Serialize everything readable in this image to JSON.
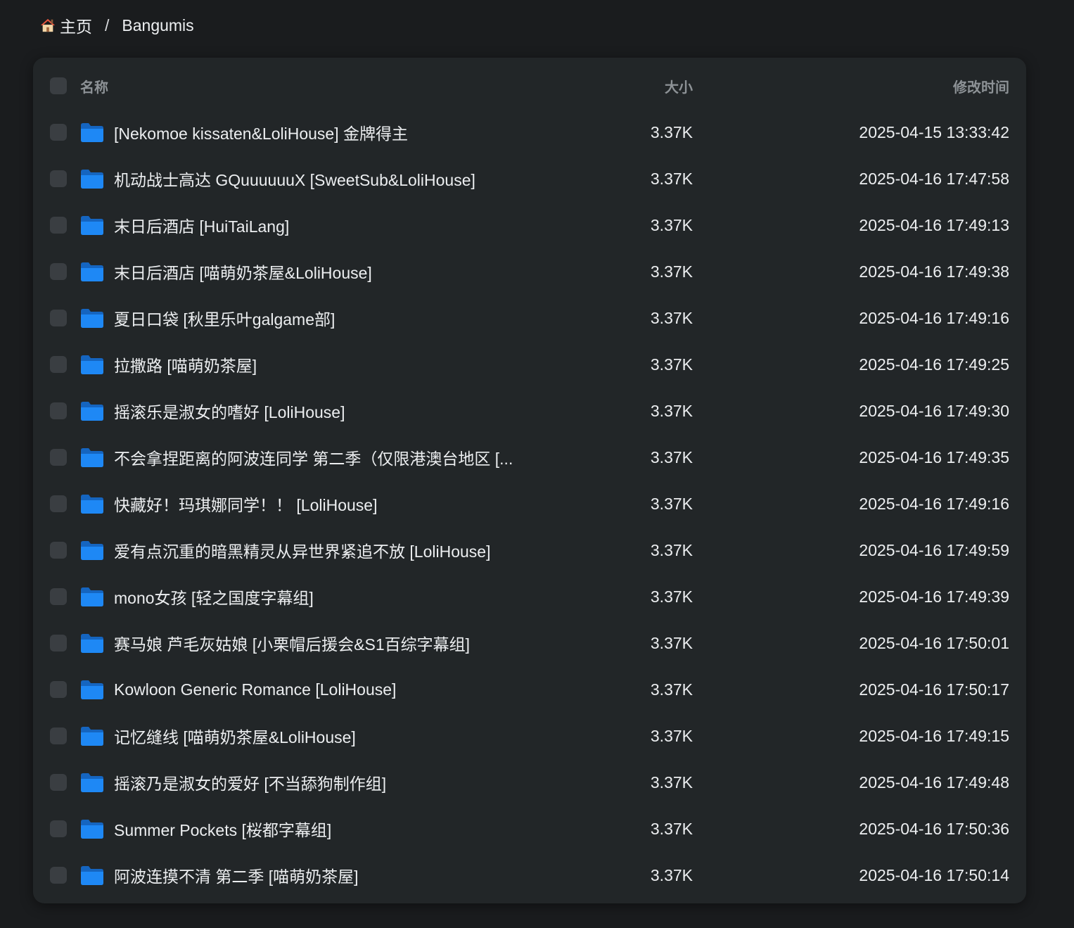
{
  "breadcrumb": {
    "home_label": "主页",
    "separator": "/",
    "current": "Bangumis",
    "home_icon": "house-icon"
  },
  "table": {
    "columns": {
      "name": "名称",
      "size": "大小",
      "modified": "修改时间"
    },
    "folder_icon": "folder-icon",
    "accent_color": "#1e88f5",
    "rows": [
      {
        "name": "[Nekomoe kissaten&LoliHouse] 金牌得主",
        "size": "3.37K",
        "modified": "2025-04-15 13:33:42"
      },
      {
        "name": "机动战士高达 GQuuuuuuX [SweetSub&LoliHouse]",
        "size": "3.37K",
        "modified": "2025-04-16 17:47:58"
      },
      {
        "name": "末日后酒店 [HuiTaiLang]",
        "size": "3.37K",
        "modified": "2025-04-16 17:49:13"
      },
      {
        "name": "末日后酒店 [喵萌奶茶屋&LoliHouse]",
        "size": "3.37K",
        "modified": "2025-04-16 17:49:38"
      },
      {
        "name": "夏日口袋 [秋里乐叶galgame部]",
        "size": "3.37K",
        "modified": "2025-04-16 17:49:16"
      },
      {
        "name": "拉撒路 [喵萌奶茶屋]",
        "size": "3.37K",
        "modified": "2025-04-16 17:49:25"
      },
      {
        "name": "摇滚乐是淑女的嗜好 [LoliHouse]",
        "size": "3.37K",
        "modified": "2025-04-16 17:49:30"
      },
      {
        "name": "不会拿捏距离的阿波连同学 第二季（仅限港澳台地区 [...",
        "size": "3.37K",
        "modified": "2025-04-16 17:49:35"
      },
      {
        "name": "快藏好！玛琪娜同学！！ [LoliHouse]",
        "size": "3.37K",
        "modified": "2025-04-16 17:49:16"
      },
      {
        "name": "爱有点沉重的暗黑精灵从异世界紧追不放 [LoliHouse]",
        "size": "3.37K",
        "modified": "2025-04-16 17:49:59"
      },
      {
        "name": "mono女孩 [轻之国度字幕组]",
        "size": "3.37K",
        "modified": "2025-04-16 17:49:39"
      },
      {
        "name": "赛马娘 芦毛灰姑娘 [小栗帽后援会&S1百综字幕组]",
        "size": "3.37K",
        "modified": "2025-04-16 17:50:01"
      },
      {
        "name": "Kowloon Generic Romance [LoliHouse]",
        "size": "3.37K",
        "modified": "2025-04-16 17:50:17"
      },
      {
        "name": "记忆缝线 [喵萌奶茶屋&LoliHouse]",
        "size": "3.37K",
        "modified": "2025-04-16 17:49:15"
      },
      {
        "name": "摇滚乃是淑女的爱好 [不当舔狗制作组]",
        "size": "3.37K",
        "modified": "2025-04-16 17:49:48"
      },
      {
        "name": "Summer Pockets [桜都字幕组]",
        "size": "3.37K",
        "modified": "2025-04-16 17:50:36"
      },
      {
        "name": "阿波连摸不清 第二季 [喵萌奶茶屋]",
        "size": "3.37K",
        "modified": "2025-04-16 17:50:14"
      }
    ]
  }
}
